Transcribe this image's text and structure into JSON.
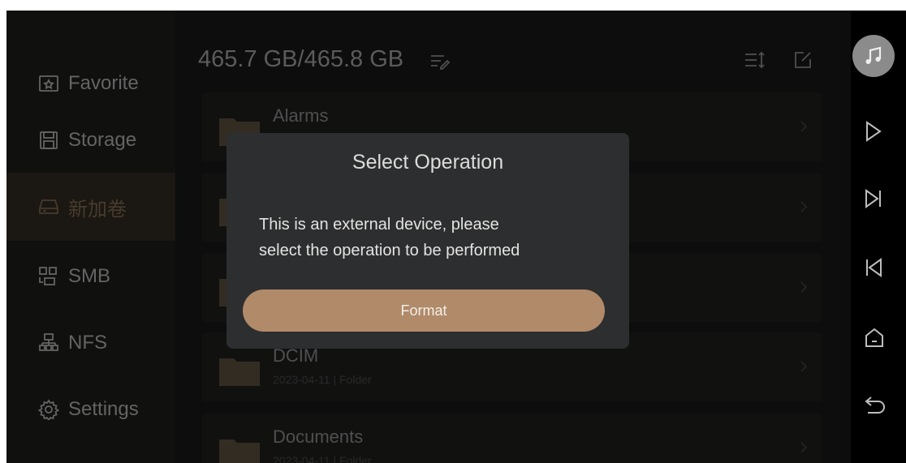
{
  "sidebar": {
    "items": [
      {
        "label": "Favorite",
        "icon": "star-folder-icon",
        "active": false
      },
      {
        "label": "Storage",
        "icon": "storage-icon",
        "active": false
      },
      {
        "label": "新加卷",
        "icon": "drive-icon",
        "active": true
      },
      {
        "label": "SMB",
        "icon": "network-share-icon",
        "active": false
      },
      {
        "label": "NFS",
        "icon": "network-tree-icon",
        "active": false
      },
      {
        "label": "Settings",
        "icon": "gear-icon",
        "active": false
      }
    ]
  },
  "header": {
    "capacity": "465.7 GB/465.8 GB",
    "icons": [
      "edit-list-icon",
      "sort-icon",
      "multi-edit-icon"
    ]
  },
  "files": [
    {
      "name": "Alarms",
      "meta": ""
    },
    {
      "name": "",
      "meta": ""
    },
    {
      "name": "",
      "meta": ""
    },
    {
      "name": "DCIM",
      "meta": "2023-04-11  |  Folder"
    },
    {
      "name": "Documents",
      "meta": "2023-04-11  |  Folder"
    }
  ],
  "dialog": {
    "title": "Select Operation",
    "message_line1": "This is an external device, please",
    "message_line2": "select the operation to be performed",
    "format_label": "Format"
  },
  "controls": {
    "icons": [
      "music-icon",
      "play-icon",
      "next-icon",
      "previous-icon",
      "home-icon",
      "back-icon"
    ]
  },
  "colors": {
    "accent": "#b08a69",
    "background": "#141414",
    "dialog": "#2d2e2f"
  }
}
